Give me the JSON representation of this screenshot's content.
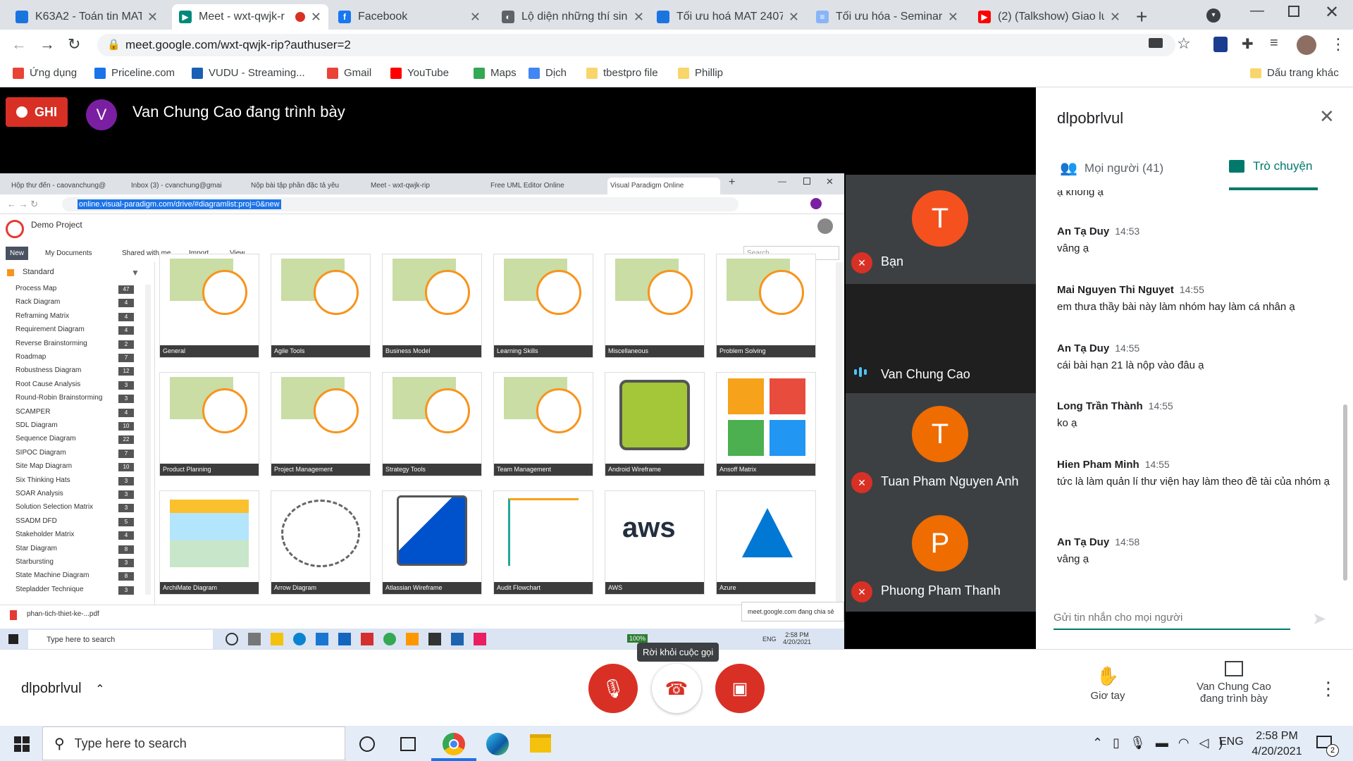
{
  "browser": {
    "tabs": [
      {
        "title": "K63A2 - Toán tin MAT",
        "color": "#1a73e8",
        "glyph": "👤"
      },
      {
        "title": "Meet - wxt-qwjk-r",
        "color": "#00897b",
        "glyph": "▶"
      },
      {
        "title": "Facebook",
        "color": "#1877f2",
        "glyph": "f"
      },
      {
        "title": "Lộ diện những thí sinh",
        "color": "#5f6368",
        "glyph": "◐"
      },
      {
        "title": "Tối ưu hoá MAT 2407",
        "color": "#1a73e8",
        "glyph": "👤"
      },
      {
        "title": "Tối ưu hóa - Seminar",
        "color": "#8ab4f8",
        "glyph": "≡"
      },
      {
        "title": "(2) (Talkshow) Giao lư",
        "color": "#ff0000",
        "glyph": "▶"
      }
    ],
    "url": "meet.google.com/wxt-qwjk-rip?authuser=2",
    "bookmarks": [
      {
        "label": "Ứng dụng",
        "color": "#ea4335"
      },
      {
        "label": "Priceline.com",
        "color": "#1a73e8"
      },
      {
        "label": "VUDU - Streaming...",
        "color": "#1a5fb4"
      },
      {
        "label": "Gmail",
        "color": "#ea4335"
      },
      {
        "label": "YouTube",
        "color": "#ff0000"
      },
      {
        "label": "Maps",
        "color": "#34a853"
      },
      {
        "label": "Dịch",
        "color": "#4285f4"
      },
      {
        "label": "tbestpro file",
        "color": "#f9d66b"
      },
      {
        "label": "Phillip",
        "color": "#f9d66b"
      }
    ],
    "other_bookmarks": "Dấu trang khác"
  },
  "meet": {
    "record_label": "GHI",
    "presenter_initial": "V",
    "presenter_status": "Van Chung Cao đang trình bày",
    "meeting_code": "dlpobrlvul",
    "participants": [
      {
        "name": "Bạn",
        "initial": "T",
        "color": "#f4511e",
        "muted": true
      },
      {
        "name": "Van Chung Cao",
        "initial": "",
        "color": "",
        "muted": false
      },
      {
        "name": "Tuan Pham Nguyen Anh",
        "initial": "T",
        "color": "#ef6c00",
        "muted": true
      },
      {
        "name": "Phuong Pham Thanh",
        "initial": "P",
        "color": "#ef6c00",
        "muted": true
      }
    ],
    "panel": {
      "title": "dlpobrlvul",
      "tab_people": "Mọi người (41)",
      "tab_chat": "Trò chuyện",
      "cut_text": "ạ không ạ",
      "messages": [
        {
          "name": "An Tạ Duy",
          "time": "14:53",
          "text": "vâng ạ"
        },
        {
          "name": "Mai Nguyen Thi Nguyet",
          "time": "14:55",
          "text": "em thưa thầy bài này làm nhóm hay làm cá nhân ạ"
        },
        {
          "name": "An Tạ Duy",
          "time": "14:55",
          "text": "cái bài hạn 21 là nộp vào đâu ạ"
        },
        {
          "name": "Long Trần Thành",
          "time": "14:55",
          "text": "ko ạ"
        },
        {
          "name": "Hien Pham Minh",
          "time": "14:55",
          "text": "tức là làm quản lí thư viện hay làm theo đề tài của nhóm ạ"
        },
        {
          "name": "An Tạ Duy",
          "time": "14:58",
          "text": "vâng ạ"
        }
      ],
      "input_placeholder": "Gửi tin nhắn cho mọi người"
    },
    "bottom": {
      "meeting_code": "dlpobrlvul",
      "leave_tooltip": "Rời khỏi cuộc gọi",
      "raise_hand": "Giơ tay",
      "presenting_line1": "Van Chung Cao",
      "presenting_line2": "đang trình bày"
    }
  },
  "shared_screen": {
    "tabs": [
      "Hộp thư đến - caovanchung@",
      "Inbox (3) - cvanchung@gmai",
      "Nộp bài tập phần đặc tả yêu",
      "Meet - wxt-qwjk-rip",
      "Free UML Editor Online",
      "Visual Paradigm Online"
    ],
    "url": "online.visual-paradigm.com/drive/#diagramlist:proj=0&new",
    "project": "Demo Project",
    "menu": [
      "New",
      "My Documents",
      "Shared with me",
      "Import",
      "View"
    ],
    "search_placeholder": "Search",
    "sidebar_title": "Standard",
    "sidebar_items": [
      {
        "label": "Process Map",
        "count": "47"
      },
      {
        "label": "Rack Diagram",
        "count": "4"
      },
      {
        "label": "Reframing Matrix",
        "count": "4"
      },
      {
        "label": "Requirement Diagram",
        "count": "4"
      },
      {
        "label": "Reverse Brainstorming",
        "count": "2"
      },
      {
        "label": "Roadmap",
        "count": "7"
      },
      {
        "label": "Robustness Diagram",
        "count": "12"
      },
      {
        "label": "Root Cause Analysis",
        "count": "3"
      },
      {
        "label": "Round-Robin Brainstorming",
        "count": "3"
      },
      {
        "label": "SCAMPER",
        "count": "4"
      },
      {
        "label": "SDL Diagram",
        "count": "10"
      },
      {
        "label": "Sequence Diagram",
        "count": "22"
      },
      {
        "label": "SIPOC Diagram",
        "count": "7"
      },
      {
        "label": "Site Map Diagram",
        "count": "10"
      },
      {
        "label": "Six Thinking Hats",
        "count": "3"
      },
      {
        "label": "SOAR Analysis",
        "count": "3"
      },
      {
        "label": "Solution Selection Matrix",
        "count": "3"
      },
      {
        "label": "SSADM DFD",
        "count": "5"
      },
      {
        "label": "Stakeholder Matrix",
        "count": "4"
      },
      {
        "label": "Star Diagram",
        "count": "8"
      },
      {
        "label": "Starbursting",
        "count": "3"
      },
      {
        "label": "State Machine Diagram",
        "count": "8"
      },
      {
        "label": "Stepladder Technique",
        "count": "3"
      }
    ],
    "tiles": [
      "General",
      "Agile Tools",
      "Business Model",
      "Learning Skills",
      "Miscellaneous",
      "Problem Solving",
      "Product Planning",
      "Project Management",
      "Strategy Tools",
      "Team Management",
      "Android Wireframe",
      "Ansoff Matrix",
      "ArchiMate Diagram",
      "Arrow Diagram",
      "Atlassian Wireframe",
      "Audit Flowchart",
      "AWS",
      "Azure"
    ],
    "download_file": "phan-tich-thiet-ke-...pdf",
    "share_notice": "meet.google.com đang chia sẻ",
    "inner_taskbar": {
      "search": "Type here to search",
      "battery": "100%",
      "lang": "ENG",
      "time": "2:58 PM",
      "date": "4/20/2021"
    }
  },
  "taskbar": {
    "search_placeholder": "Type here to search",
    "lang": "ENG",
    "time": "2:58 PM",
    "date": "4/20/2021",
    "notif_count": "2"
  }
}
